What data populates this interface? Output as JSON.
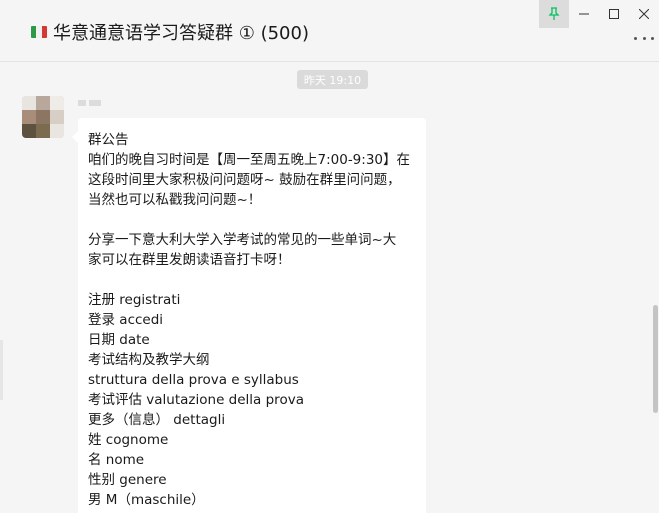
{
  "header": {
    "title": "华意通意语学习答疑群 ① (500)",
    "flag_icon": "italy-flag-icon",
    "window_controls": [
      "pin",
      "minimize",
      "maximize",
      "close"
    ]
  },
  "chat": {
    "timestamp": "昨天 19:10",
    "message_lines": [
      "群公告",
      "咱们的晚自习时间是【周一至周五晚上7:00-9:30】在",
      "这段时间里大家积极问问题呀~ 鼓励在群里问问题，",
      "当然也可以私戳我问问题~！",
      "",
      "分享一下意大利大学入学考试的常见的一些单词~大",
      "家可以在群里发朗读语音打卡呀！",
      "",
      "注册  registrati",
      "登录  accedi",
      "日期  date",
      "考试结构及教学大纲",
      "struttura della prova e syllabus",
      "考试评估  valutazione della prova",
      "更多（信息） dettagli",
      "姓  cognome",
      "名  nome",
      "性别  genere",
      "男  M（maschile）"
    ]
  },
  "colors": {
    "background": "#f5f5f5",
    "bubble": "#ffffff",
    "pin_active": "#07c160",
    "timestamp_bg": "#dadada"
  }
}
